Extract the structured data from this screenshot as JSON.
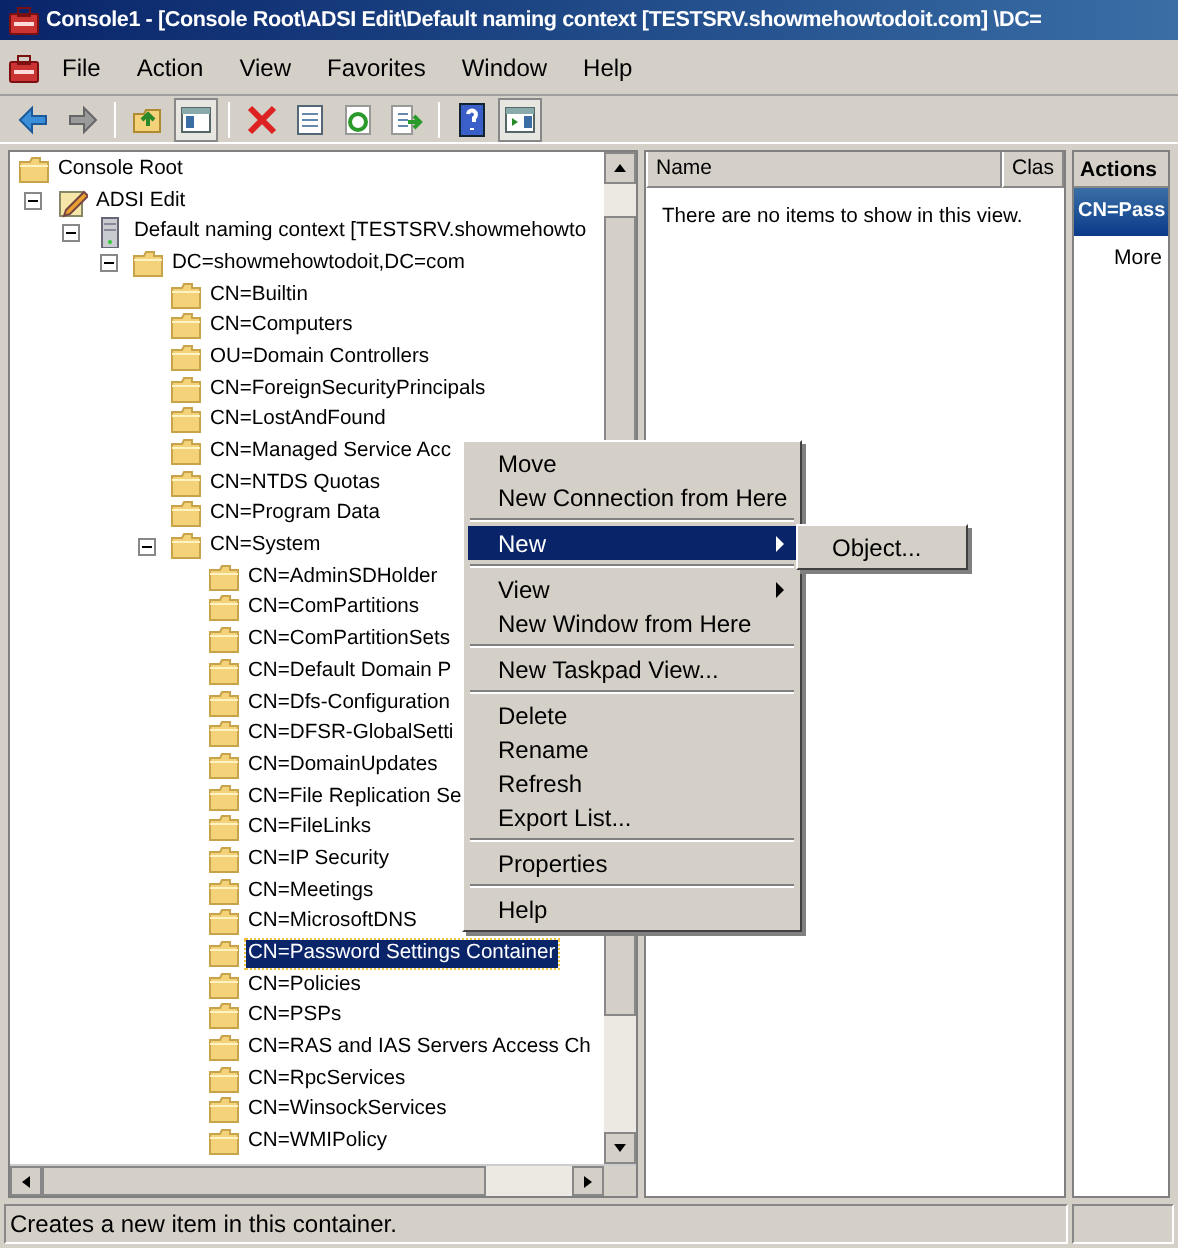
{
  "window": {
    "title": "Console1 - [Console Root\\ADSI Edit\\Default naming context [TESTSRV.showmehowtodoit.com] \\DC="
  },
  "menu_bar": [
    "File",
    "Action",
    "View",
    "Favorites",
    "Window",
    "Help"
  ],
  "tree": [
    {
      "label": "Console Root",
      "kind": "folder",
      "selected": false,
      "children": [
        {
          "label": "ADSI Edit",
          "kind": "snapin",
          "expanded": true,
          "selected": false,
          "children": [
            {
              "label": "Default naming context [TESTSRV.showmehowto",
              "kind": "server",
              "expanded": true,
              "selected": false,
              "children": [
                {
                  "label": "DC=showmehowtodoit,DC=com",
                  "kind": "folder",
                  "expanded": true,
                  "selected": false,
                  "children": [
                    {
                      "label": "CN=Builtin",
                      "kind": "folder",
                      "selected": false
                    },
                    {
                      "label": "CN=Computers",
                      "kind": "folder",
                      "selected": false
                    },
                    {
                      "label": "OU=Domain Controllers",
                      "kind": "folder",
                      "selected": false
                    },
                    {
                      "label": "CN=ForeignSecurityPrincipals",
                      "kind": "folder",
                      "selected": false
                    },
                    {
                      "label": "CN=LostAndFound",
                      "kind": "folder",
                      "selected": false
                    },
                    {
                      "label": "CN=Managed Service Acc",
                      "kind": "folder",
                      "selected": false
                    },
                    {
                      "label": "CN=NTDS Quotas",
                      "kind": "folder",
                      "selected": false
                    },
                    {
                      "label": "CN=Program Data",
                      "kind": "folder",
                      "selected": false
                    },
                    {
                      "label": "CN=System",
                      "kind": "folder",
                      "expanded": true,
                      "selected": false,
                      "children": [
                        {
                          "label": "CN=AdminSDHolder",
                          "kind": "folder",
                          "selected": false
                        },
                        {
                          "label": "CN=ComPartitions",
                          "kind": "folder",
                          "selected": false
                        },
                        {
                          "label": "CN=ComPartitionSets",
                          "kind": "folder",
                          "selected": false
                        },
                        {
                          "label": "CN=Default Domain P",
                          "kind": "folder",
                          "selected": false
                        },
                        {
                          "label": "CN=Dfs-Configuration",
                          "kind": "folder",
                          "selected": false
                        },
                        {
                          "label": "CN=DFSR-GlobalSetti",
                          "kind": "folder",
                          "selected": false
                        },
                        {
                          "label": "CN=DomainUpdates",
                          "kind": "folder",
                          "selected": false
                        },
                        {
                          "label": "CN=File Replication Se",
                          "kind": "folder",
                          "selected": false
                        },
                        {
                          "label": "CN=FileLinks",
                          "kind": "folder",
                          "selected": false
                        },
                        {
                          "label": "CN=IP Security",
                          "kind": "folder",
                          "selected": false
                        },
                        {
                          "label": "CN=Meetings",
                          "kind": "folder",
                          "selected": false
                        },
                        {
                          "label": "CN=MicrosoftDNS",
                          "kind": "folder",
                          "selected": false
                        },
                        {
                          "label": "CN=Password Settings Container",
                          "kind": "folder",
                          "selected": true
                        },
                        {
                          "label": "CN=Policies",
                          "kind": "folder",
                          "selected": false
                        },
                        {
                          "label": "CN=PSPs",
                          "kind": "folder",
                          "selected": false
                        },
                        {
                          "label": "CN=RAS and IAS Servers Access Ch",
                          "kind": "folder",
                          "selected": false
                        },
                        {
                          "label": "CN=RpcServices",
                          "kind": "folder",
                          "selected": false
                        },
                        {
                          "label": "CN=WinsockServices",
                          "kind": "folder",
                          "selected": false
                        },
                        {
                          "label": "CN=WMIPolicy",
                          "kind": "folder",
                          "selected": false
                        }
                      ]
                    }
                  ]
                }
              ]
            }
          ]
        }
      ]
    }
  ],
  "list_view": {
    "columns": [
      "Name",
      "Clas"
    ],
    "empty_message": "There are no items to show in this view."
  },
  "actions_pane": {
    "title": "Actions",
    "section": "CN=Pass",
    "items": [
      "More"
    ]
  },
  "context_menu": [
    {
      "kind": "item",
      "label": "Move",
      "selected": false,
      "submenu": false
    },
    {
      "kind": "item",
      "label": "New Connection from Here",
      "selected": false,
      "submenu": false
    },
    {
      "kind": "separator"
    },
    {
      "kind": "item",
      "label": "New",
      "selected": true,
      "submenu": true
    },
    {
      "kind": "separator"
    },
    {
      "kind": "item",
      "label": "View",
      "selected": false,
      "submenu": true
    },
    {
      "kind": "item",
      "label": "New Window from Here",
      "selected": false,
      "submenu": false
    },
    {
      "kind": "separator"
    },
    {
      "kind": "item",
      "label": "New Taskpad View...",
      "selected": false,
      "submenu": false
    },
    {
      "kind": "separator"
    },
    {
      "kind": "item",
      "label": "Delete",
      "selected": false,
      "submenu": false
    },
    {
      "kind": "item",
      "label": "Rename",
      "selected": false,
      "submenu": false
    },
    {
      "kind": "item",
      "label": "Refresh",
      "selected": false,
      "submenu": false
    },
    {
      "kind": "item",
      "label": "Export List...",
      "selected": false,
      "submenu": false
    },
    {
      "kind": "separator"
    },
    {
      "kind": "item",
      "label": "Properties",
      "selected": false,
      "submenu": false
    },
    {
      "kind": "separator"
    },
    {
      "kind": "item",
      "label": "Help",
      "selected": false,
      "submenu": false
    }
  ],
  "submenu": [
    {
      "label": "Object...",
      "selected": false
    }
  ],
  "status_bar": "Creates a new item in this container."
}
